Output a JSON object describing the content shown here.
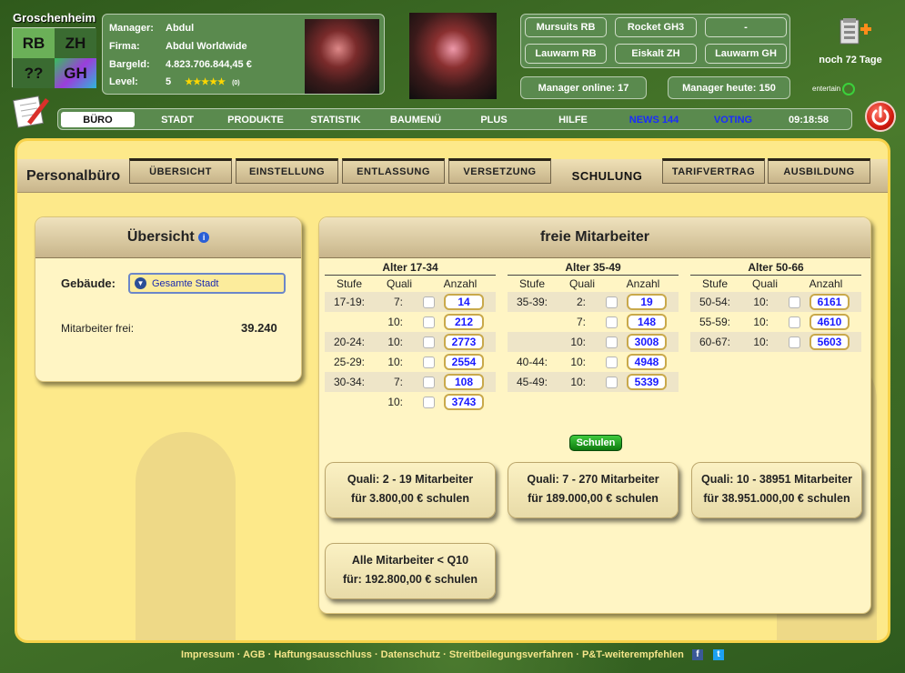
{
  "header": {
    "city": "Groschenheim",
    "city_block": {
      "tl": "RB",
      "tr": "ZH",
      "bl": "??",
      "br": "GH",
      "colors": {
        "tl": "#6bb058",
        "tr": "#3a6b31",
        "bl": "#3a6b31",
        "br": "#35c15a"
      }
    },
    "manager": {
      "manager_label": "Manager:",
      "manager": "Abdul",
      "firma_label": "Firma:",
      "firma": "Abdul Worldwide",
      "bargeld_label": "Bargeld:",
      "bargeld": "4.823.706.844,45 €",
      "level_label": "Level:",
      "level": "5",
      "stars": "★★★★★",
      "stars_count": "(0)"
    },
    "teams": [
      "Mursuits RB",
      "Rocket GH3",
      "-",
      "Lauwarm RB",
      "Eiskalt ZH",
      "Lauwarm GH"
    ],
    "online_label": "Manager online:",
    "online": "17",
    "heute_label": "Manager heute:",
    "heute": "150",
    "days": "noch 72 Tage",
    "entertain": "entertain"
  },
  "nav": {
    "items": [
      "BÜRO",
      "STADT",
      "PRODUKTE",
      "STATISTIK",
      "BAUMENÜ",
      "PLUS",
      "HILFE",
      "NEWS 144",
      "VOTING"
    ],
    "time": "09:18:58"
  },
  "tabs": {
    "title": "Personalbüro",
    "items": [
      "ÜBERSICHT",
      "EINSTELLUNG",
      "ENTLASSUNG",
      "VERSETZUNG",
      "SCHULUNG",
      "TARIFVERTRAG",
      "AUSBILDUNG"
    ]
  },
  "uebersicht": {
    "title": "Übersicht",
    "gebaeude_label": "Gebäude:",
    "gebaeude_value": "Gesamte Stadt",
    "frei_label": "Mitarbeiter frei:",
    "frei_value": "39.240"
  },
  "freie": {
    "title": "freie Mitarbeiter",
    "col_stufe": "Stufe",
    "col_quali": "Quali",
    "col_anzahl": "Anzahl",
    "groups": [
      {
        "title": "Alter 17-34",
        "rows": [
          [
            "17-19:",
            "7:",
            "14"
          ],
          [
            "",
            "10:",
            "212"
          ],
          [
            "20-24:",
            "10:",
            "2773"
          ],
          [
            "25-29:",
            "10:",
            "2554"
          ],
          [
            "30-34:",
            "7:",
            "108"
          ],
          [
            "",
            "10:",
            "3743"
          ]
        ]
      },
      {
        "title": "Alter 35-49",
        "rows": [
          [
            "35-39:",
            "2:",
            "19"
          ],
          [
            "",
            "7:",
            "148"
          ],
          [
            "",
            "10:",
            "3008"
          ],
          [
            "40-44:",
            "10:",
            "4948"
          ],
          [
            "45-49:",
            "10:",
            "5339"
          ]
        ]
      },
      {
        "title": "Alter 50-66",
        "rows": [
          [
            "50-54:",
            "10:",
            "6161"
          ],
          [
            "55-59:",
            "10:",
            "4610"
          ],
          [
            "60-67:",
            "10:",
            "5603"
          ]
        ]
      }
    ],
    "schulen": "Schulen",
    "buttons": [
      {
        "l1": "Quali: 2 - 19 Mitarbeiter",
        "l2": "für 3.800,00 € schulen"
      },
      {
        "l1": "Quali: 7 - 270 Mitarbeiter",
        "l2": "für 189.000,00 € schulen"
      },
      {
        "l1": "Quali: 10 - 38951 Mitarbeiter",
        "l2": "für 38.951.000,00 € schulen"
      },
      {
        "l1": "Alle Mitarbeiter < Q10",
        "l2": "für: 192.800,00 € schulen"
      }
    ]
  },
  "footer": {
    "links": "Impressum · AGB · Haftungsausschluss · Datenschutz · Streitbeilegungsverfahren · P&T-weiterempfehlen",
    "fb": "f",
    "tw": "t"
  }
}
